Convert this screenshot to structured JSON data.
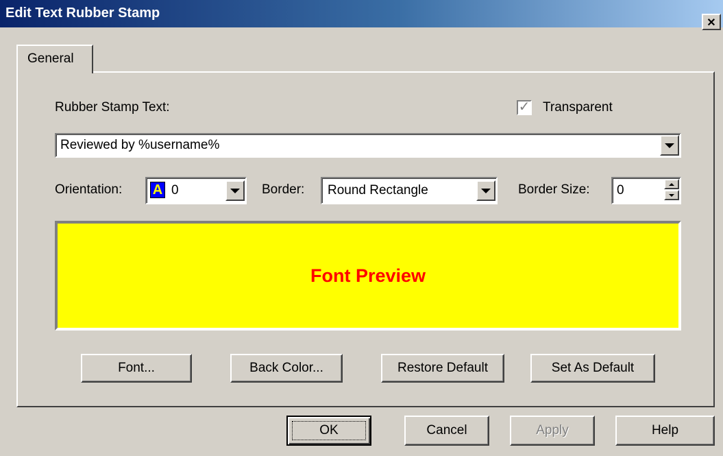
{
  "window": {
    "title": "Edit Text Rubber Stamp",
    "close_glyph": "✕"
  },
  "tabs": [
    {
      "label": "General"
    }
  ],
  "stamp_text": {
    "label": "Rubber Stamp Text:",
    "value": "Reviewed by %username%"
  },
  "transparent": {
    "label": "Transparent",
    "checked": true,
    "check_glyph": "✓"
  },
  "orientation": {
    "label": "Orientation:",
    "icon_letter": "A",
    "value": "0"
  },
  "border": {
    "label": "Border:",
    "value": "Round Rectangle"
  },
  "border_size": {
    "label": "Border Size:",
    "value": "0"
  },
  "preview": {
    "text": "Font Preview",
    "background": "#ffff00",
    "text_color": "#ff0000"
  },
  "buttons": {
    "font": "Font...",
    "back_color": "Back Color...",
    "restore_default": "Restore Default",
    "set_as_default": "Set As Default"
  },
  "footer": {
    "ok": "OK",
    "cancel": "Cancel",
    "apply": "Apply",
    "help": "Help"
  }
}
